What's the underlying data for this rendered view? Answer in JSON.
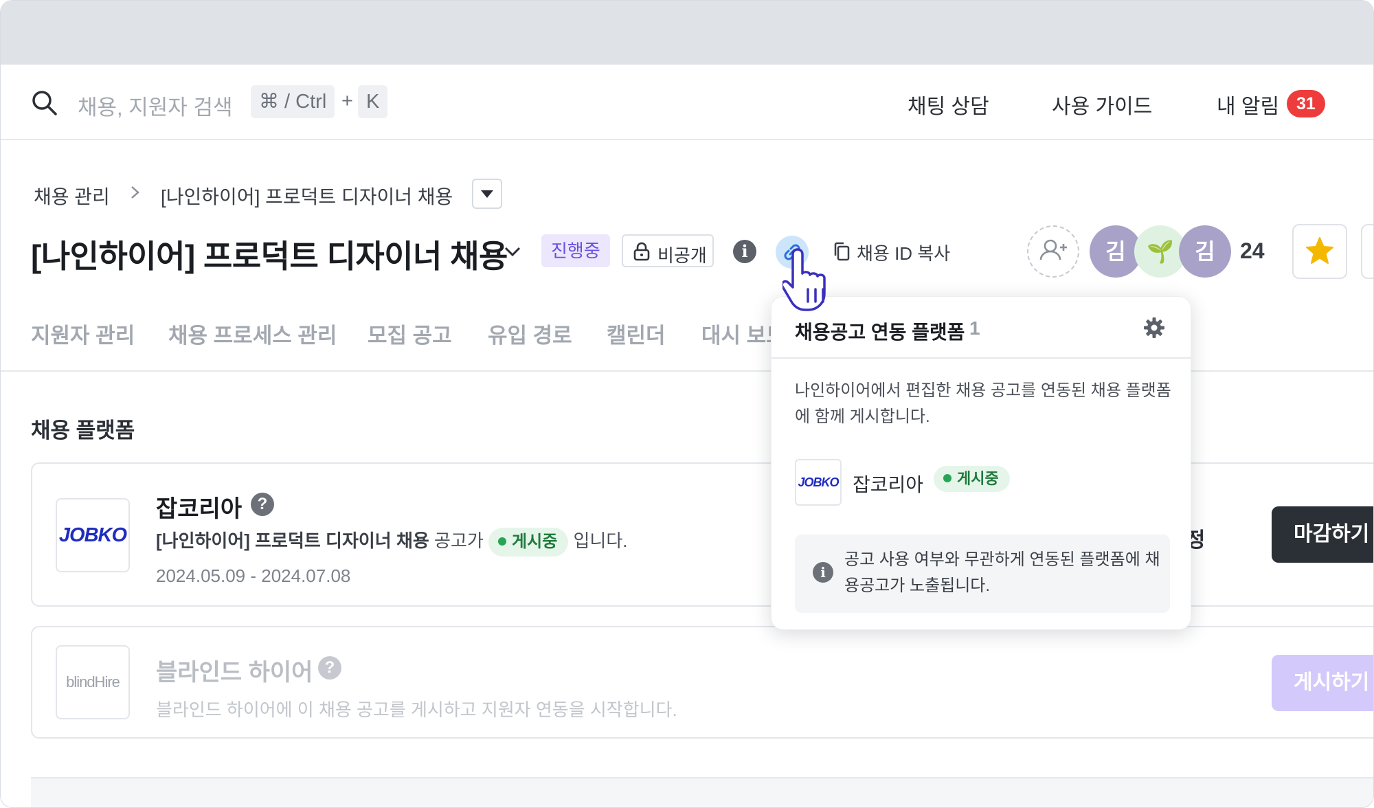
{
  "header": {
    "search_placeholder": "채용, 지원자 검색",
    "shortcut_key1": "⌘ / Ctrl",
    "shortcut_plus": "+",
    "shortcut_key2": "K",
    "chat_link": "채팅 상담",
    "guide_link": "사용 가이드",
    "alerts_label": "내 알림",
    "alerts_count": "31"
  },
  "breadcrumb": {
    "root": "채용 관리",
    "current": "[나인하이어] 프로덕트 디자이너 채용"
  },
  "job": {
    "title": "[나인하이어] 프로덕트 디자이너 채용",
    "status": "진행중",
    "visibility": "비공개",
    "copy_id_label": "채용 ID 복사",
    "members": [
      {
        "initial": "김",
        "color": "#a8a2c8"
      },
      {
        "initial": "🌱",
        "color": "#dff2e2"
      },
      {
        "initial": "김",
        "color": "#a8a2c8"
      }
    ],
    "member_count": "24",
    "icons": {
      "link": "link-icon",
      "info": "info-icon",
      "copy": "copy-icon",
      "add_user": "add-user-icon",
      "star": "star-icon",
      "lock": "lock-icon"
    }
  },
  "tabs": [
    "지원자 관리",
    "채용 프로세스 관리",
    "모집 공고",
    "유입 경로",
    "캘린더",
    "대시 보드"
  ],
  "section": {
    "title": "채용 플랫폼"
  },
  "platforms": [
    {
      "name": "잡코리아",
      "logo_text": "JOBKO",
      "desc_job": "[나인하이어] 프로덕트 디자이너 채용",
      "desc_mid": "공고가",
      "desc_status": "게시중",
      "desc_end": "입니다.",
      "dates": "2024.05.09 - 2024.07.08",
      "edit_label": "수정",
      "action_label": "마감하기"
    },
    {
      "name": "블라인드 하이어",
      "logo_text": "blindHire",
      "desc": "블라인드 하이어에 이 채용 공고를 게시하고 지원자 연동을 시작합니다.",
      "action_label": "게시하기"
    }
  ],
  "popover": {
    "title": "채용공고 연동 플랫폼",
    "count": "1",
    "description": "나인하이어에서 편집한 채용 공고를 연동된 채용 플랫폼에 함께 게시합니다.",
    "platform_name": "잡코리아",
    "platform_logo": "JOBKO",
    "platform_status": "게시중",
    "note": "공고 사용 여부와 무관하게 연동된 플랫폼에 채용공고가 노출됩니다."
  },
  "colors": {
    "accent_purple": "#6b4fe0",
    "badge_red": "#ee3b3b",
    "dark_button": "#2b2f36",
    "status_green": "#28a455"
  }
}
